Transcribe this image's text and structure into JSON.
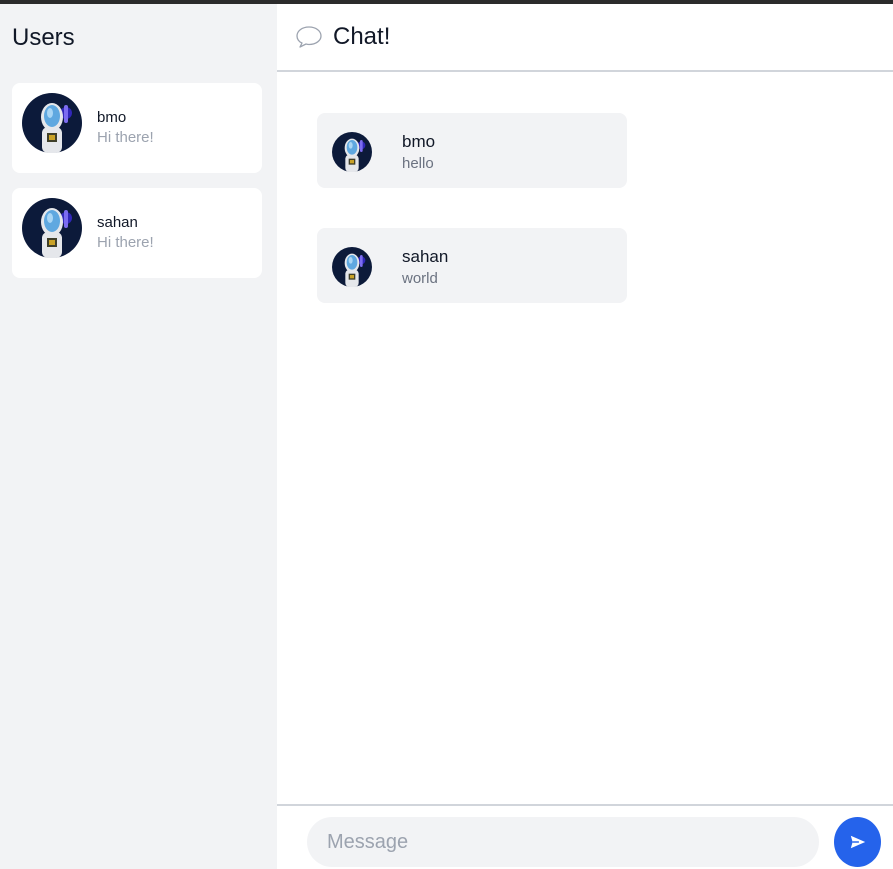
{
  "sidebar": {
    "title": "Users",
    "users": [
      {
        "name": "bmo",
        "status": "Hi there!",
        "avatar_icon": "astronaut-avatar-icon"
      },
      {
        "name": "sahan",
        "status": "Hi there!",
        "avatar_icon": "astronaut-avatar-icon"
      }
    ]
  },
  "chat": {
    "title": "Chat!",
    "header_icon": "speech-bubble-icon",
    "messages": [
      {
        "author": "bmo",
        "text": "hello"
      },
      {
        "author": "sahan",
        "text": "world"
      }
    ],
    "composer": {
      "placeholder": "Message",
      "send_icon": "send-arrow-icon"
    }
  },
  "colors": {
    "accent": "#2563eb",
    "sidebar_bg": "#f2f3f5",
    "message_bg": "#f2f3f5",
    "muted_text": "#9ca3af"
  }
}
